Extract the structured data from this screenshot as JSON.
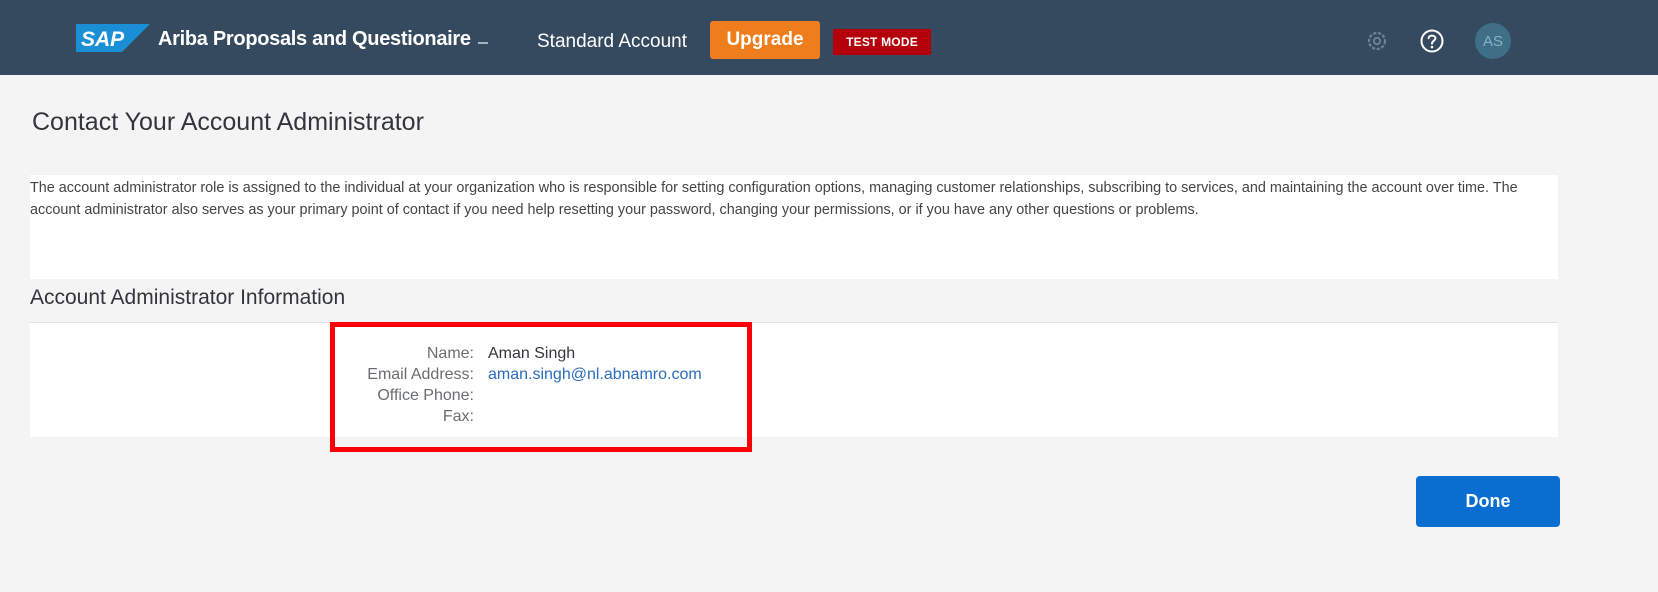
{
  "header": {
    "logo_text": "SAP",
    "app_title": "Ariba Proposals and Questionaire",
    "account_type": "Standard Account",
    "upgrade_label": "Upgrade",
    "test_mode_label": "TEST MODE",
    "avatar_initials": "AS",
    "icons": [
      "sap-logo",
      "chevron-down-icon",
      "gear-icon",
      "help-icon"
    ]
  },
  "page": {
    "title": "Contact Your Account Administrator",
    "description": "The account administrator role is assigned to the individual at your organization who is responsible for setting configuration options, managing customer relationships, subscribing to services, and maintaining the account over time. The account administrator also serves as your primary point of contact if you need help resetting your password, changing your permissions, or if you have any other questions or problems."
  },
  "admin_info": {
    "section_title": "Account Administrator Information",
    "name_label": "Name:",
    "name_value": "Aman Singh",
    "email_label": "Email Address:",
    "email_value": "aman.singh@nl.abnamro.com",
    "phone_label": "Office Phone:",
    "phone_value": "",
    "fax_label": "Fax:",
    "fax_value": ""
  },
  "actions": {
    "done_label": "Done"
  },
  "colors": {
    "header_bg": "#354a5f",
    "upgrade_bg": "#ee7d1c",
    "test_mode_bg": "#b3000b",
    "primary_button": "#0a6ed1",
    "link": "#2a6cbd",
    "highlight": "#fb0007"
  }
}
